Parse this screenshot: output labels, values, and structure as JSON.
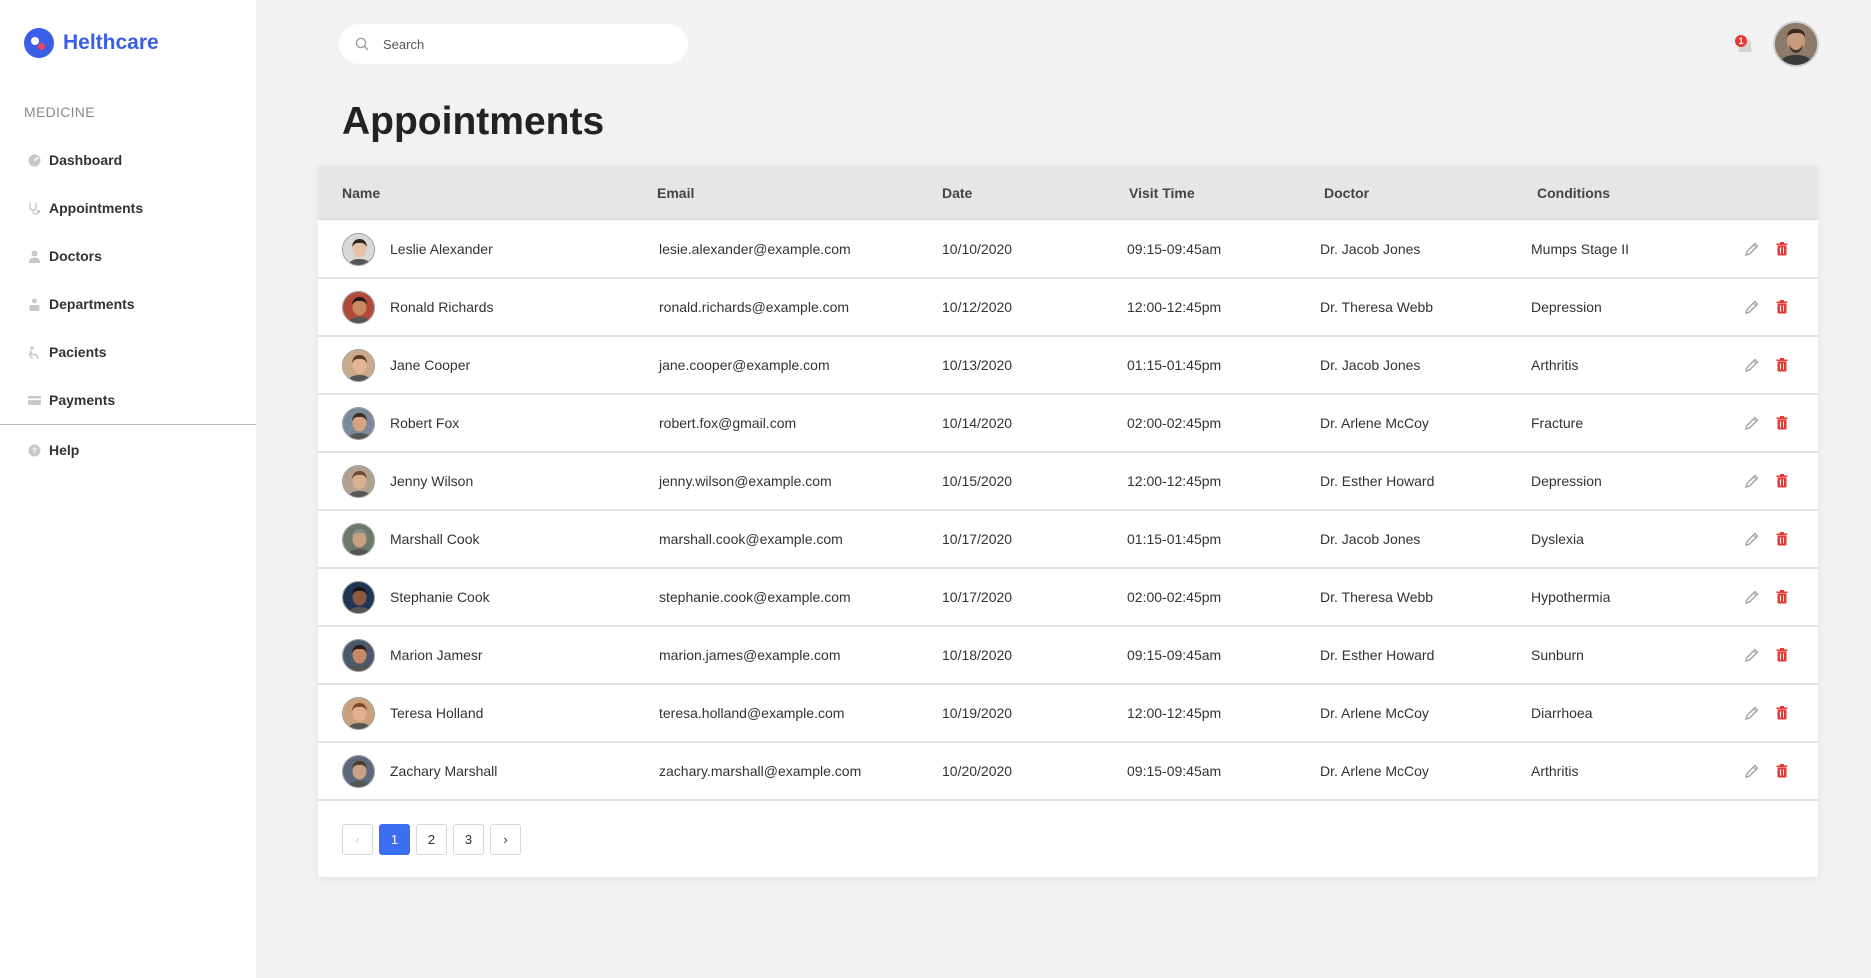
{
  "brand": {
    "name": "Helthcare",
    "accent": "#3b5ee6"
  },
  "sidebar": {
    "section_label": "MEDICINE",
    "items": [
      {
        "label": "Dashboard",
        "icon": "dashboard-icon"
      },
      {
        "label": "Appointments",
        "icon": "stethoscope-icon"
      },
      {
        "label": "Doctors",
        "icon": "doctor-icon"
      },
      {
        "label": "Departments",
        "icon": "building-icon"
      },
      {
        "label": "Pacients",
        "icon": "patient-icon"
      },
      {
        "label": "Payments",
        "icon": "card-icon"
      }
    ],
    "help": {
      "label": "Help",
      "icon": "help-icon"
    }
  },
  "header": {
    "search_placeholder": "Search",
    "notifications_count": "1"
  },
  "page": {
    "title": "Appointments"
  },
  "table": {
    "columns": [
      "Name",
      "Email",
      "Date",
      "Visit Time",
      "Doctor",
      "Conditions"
    ],
    "rows": [
      {
        "name": "Leslie Alexander",
        "email": "lesie.alexander@example.com",
        "date": "10/10/2020",
        "time": "09:15-09:45am",
        "doctor": "Dr. Jacob Jones",
        "condition": "Mumps Stage II"
      },
      {
        "name": "Ronald Richards",
        "email": "ronald.richards@example.com",
        "date": "10/12/2020",
        "time": "12:00-12:45pm",
        "doctor": "Dr. Theresa Webb",
        "condition": "Depression"
      },
      {
        "name": "Jane Cooper",
        "email": "jane.cooper@example.com",
        "date": "10/13/2020",
        "time": "01:15-01:45pm",
        "doctor": "Dr. Jacob Jones",
        "condition": "Arthritis"
      },
      {
        "name": "Robert Fox",
        "email": "robert.fox@gmail.com",
        "date": "10/14/2020",
        "time": "02:00-02:45pm",
        "doctor": "Dr. Arlene McCoy",
        "condition": "Fracture"
      },
      {
        "name": "Jenny Wilson",
        "email": "jenny.wilson@example.com",
        "date": "10/15/2020",
        "time": "12:00-12:45pm",
        "doctor": "Dr. Esther Howard",
        "condition": "Depression"
      },
      {
        "name": "Marshall Cook",
        "email": "marshall.cook@example.com",
        "date": "10/17/2020",
        "time": "01:15-01:45pm",
        "doctor": "Dr. Jacob Jones",
        "condition": "Dyslexia"
      },
      {
        "name": "Stephanie Cook",
        "email": "stephanie.cook@example.com",
        "date": "10/17/2020",
        "time": "02:00-02:45pm",
        "doctor": "Dr. Theresa Webb",
        "condition": "Hypothermia"
      },
      {
        "name": "Marion Jamesr",
        "email": "marion.james@example.com",
        "date": "10/18/2020",
        "time": "09:15-09:45am",
        "doctor": "Dr. Esther Howard",
        "condition": "Sunburn"
      },
      {
        "name": "Teresa Holland",
        "email": "teresa.holland@example.com",
        "date": "10/19/2020",
        "time": "12:00-12:45pm",
        "doctor": "Dr. Arlene McCoy",
        "condition": "Diarrhoea"
      },
      {
        "name": "Zachary Marshall",
        "email": "zachary.marshall@example.com",
        "date": "10/20/2020",
        "time": "09:15-09:45am",
        "doctor": "Dr. Arlene McCoy",
        "condition": "Arthritis"
      }
    ]
  },
  "pagination": {
    "prev": "‹",
    "next": "›",
    "pages": [
      "1",
      "2",
      "3"
    ],
    "current": "1"
  },
  "colors": {
    "delete": "#e53935",
    "edit": "#9a9a9a",
    "active_page": "#3b6ff0"
  }
}
